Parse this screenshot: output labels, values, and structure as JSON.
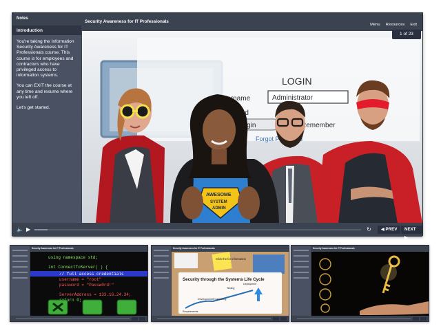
{
  "main": {
    "sidebar": {
      "header": "Notes",
      "item": "introduction",
      "paragraphs": [
        "You're taking the Information Security Awareness for IT Professionals course.   This course is for employees and contractors who have privileged access to information systems.",
        "You can EXIT the course at any time and resume where you left off.",
        "Let's get started."
      ]
    },
    "course_title": "Security Awareness for IT Professionals",
    "menu": {
      "menu": "Menu",
      "resources": "Resources",
      "exit": "Exit"
    },
    "slide_counter": "1 of 23",
    "slide": {
      "login_title": "LOGIN",
      "username_label": "Username",
      "username_value": "Administrator",
      "password_label": "Password",
      "login_button": "Login",
      "remember_label": "Remember",
      "forgot_label": "Forgot Password",
      "shirt_line1": "AWESOME",
      "shirt_line2": "SYSTEM",
      "shirt_line3": "ADMIN"
    },
    "controls": {
      "prev": "PREV",
      "next": "NEXT",
      "progress": 0.04
    }
  },
  "thumbnails": [
    {
      "code_lines": [
        "using namespace std;",
        "int ConnectToServer( ) {",
        "// full access credentials",
        "username = \"root\"",
        "password = \"Passw0rd!\"",
        "ServerAddress = 133.16.24.34;",
        "return 0;",
        "}"
      ]
    },
    {
      "sticky_note": "Click the for information",
      "title": "Security through the Systems Life Cycle",
      "stages": [
        "Requirements",
        "Development/Engineering",
        "Testing",
        "Deployment"
      ]
    },
    {
      "scene": "key-in-hand"
    }
  ],
  "colors": {
    "player_bg": "#3b4250",
    "sidebar_bg": "#4a5163",
    "cape_red": "#d8262f",
    "mask_red": "#e31c2c",
    "shirt_blue": "#2f7fd0",
    "badge_yellow": "#f3c417",
    "code_bg": "#0b0b0b",
    "code_highlight": "#2b39c9"
  }
}
